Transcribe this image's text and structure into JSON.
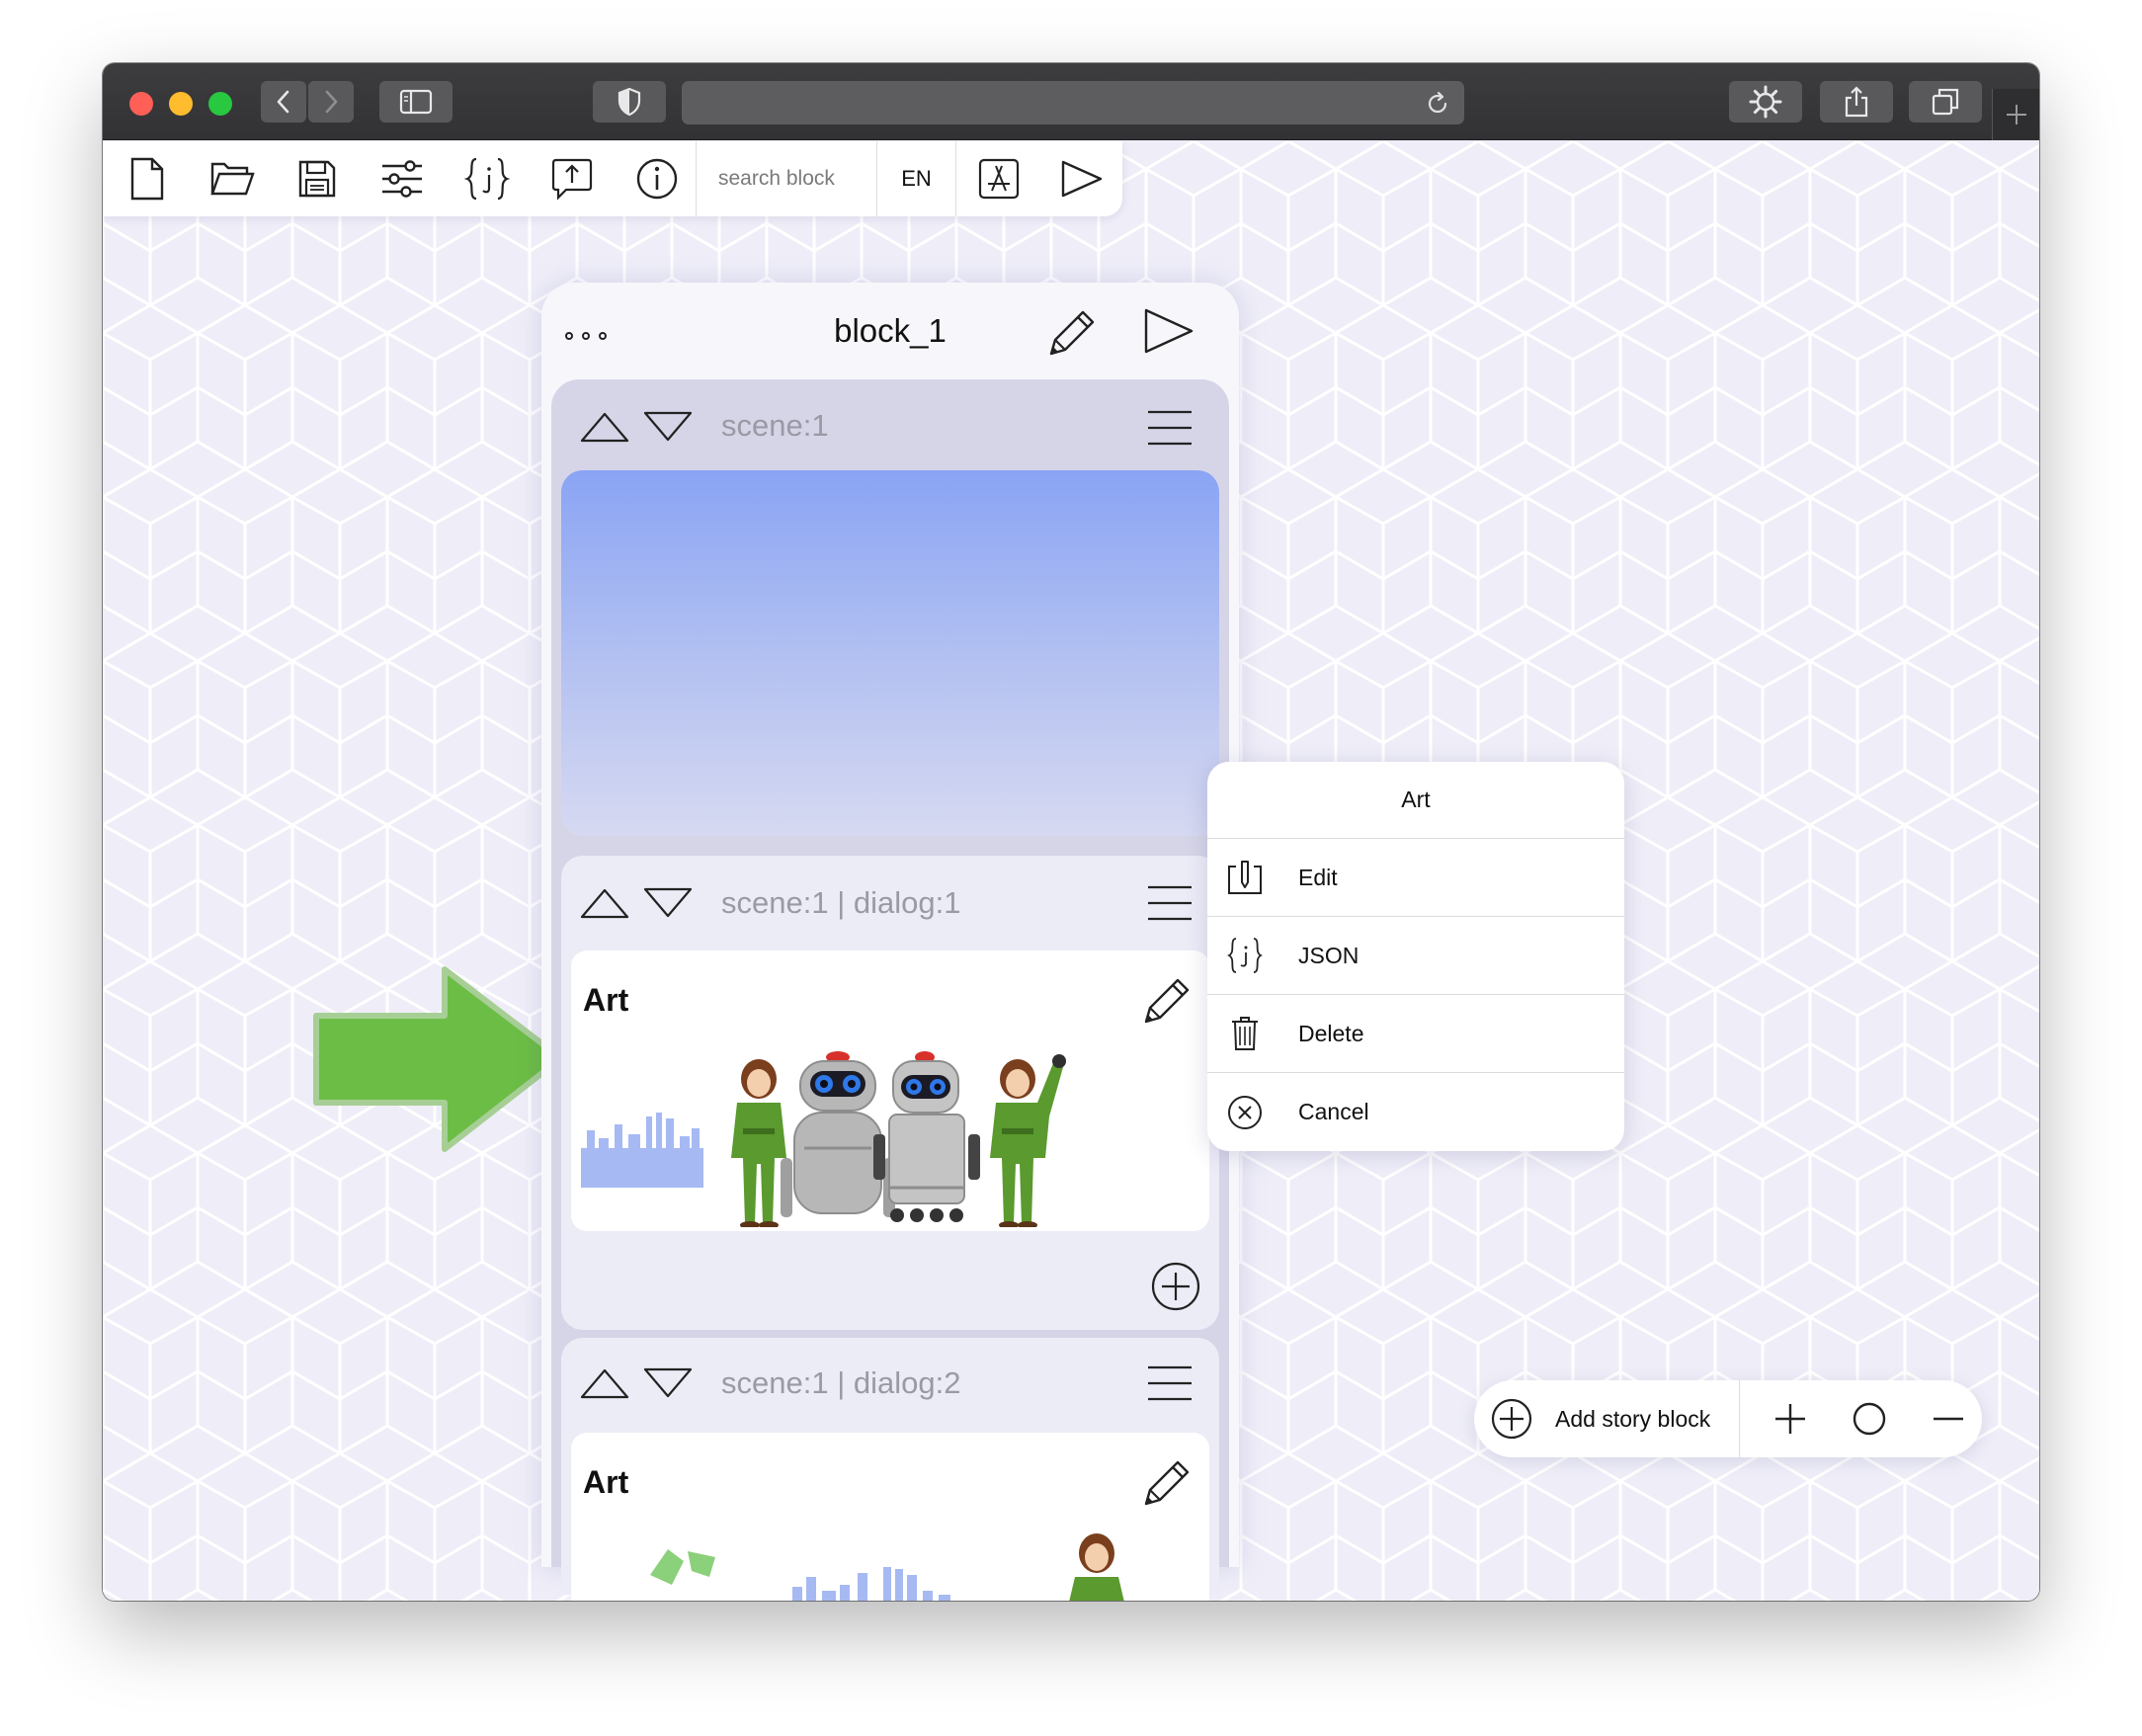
{
  "toolbar": {
    "search_placeholder": "search block",
    "language": "EN"
  },
  "block": {
    "title": "block_1",
    "scene": {
      "label": "scene:1"
    },
    "dialogs": [
      {
        "label": "scene:1 | dialog:1",
        "art_title": "Art"
      },
      {
        "label": "scene:1 | dialog:2",
        "art_title": "Art"
      }
    ]
  },
  "context_menu": {
    "title": "Art",
    "items": [
      {
        "label": "Edit",
        "icon": "edit-icon"
      },
      {
        "label": "JSON",
        "icon": "json-icon"
      },
      {
        "label": "Delete",
        "icon": "trash-icon"
      },
      {
        "label": "Cancel",
        "icon": "cancel-icon"
      }
    ]
  },
  "bottom_panel": {
    "add_label": "Add story block"
  },
  "colors": {
    "canvas_bg": "#efeef8",
    "scene_panel": "#d6d5e8",
    "dialog_bg": "#ececf7",
    "arrow_green": "#6cbd45",
    "sky_top": "#8aa4f4",
    "sky_bottom": "#d6d9f1",
    "character_green": "#5a9a2e"
  }
}
